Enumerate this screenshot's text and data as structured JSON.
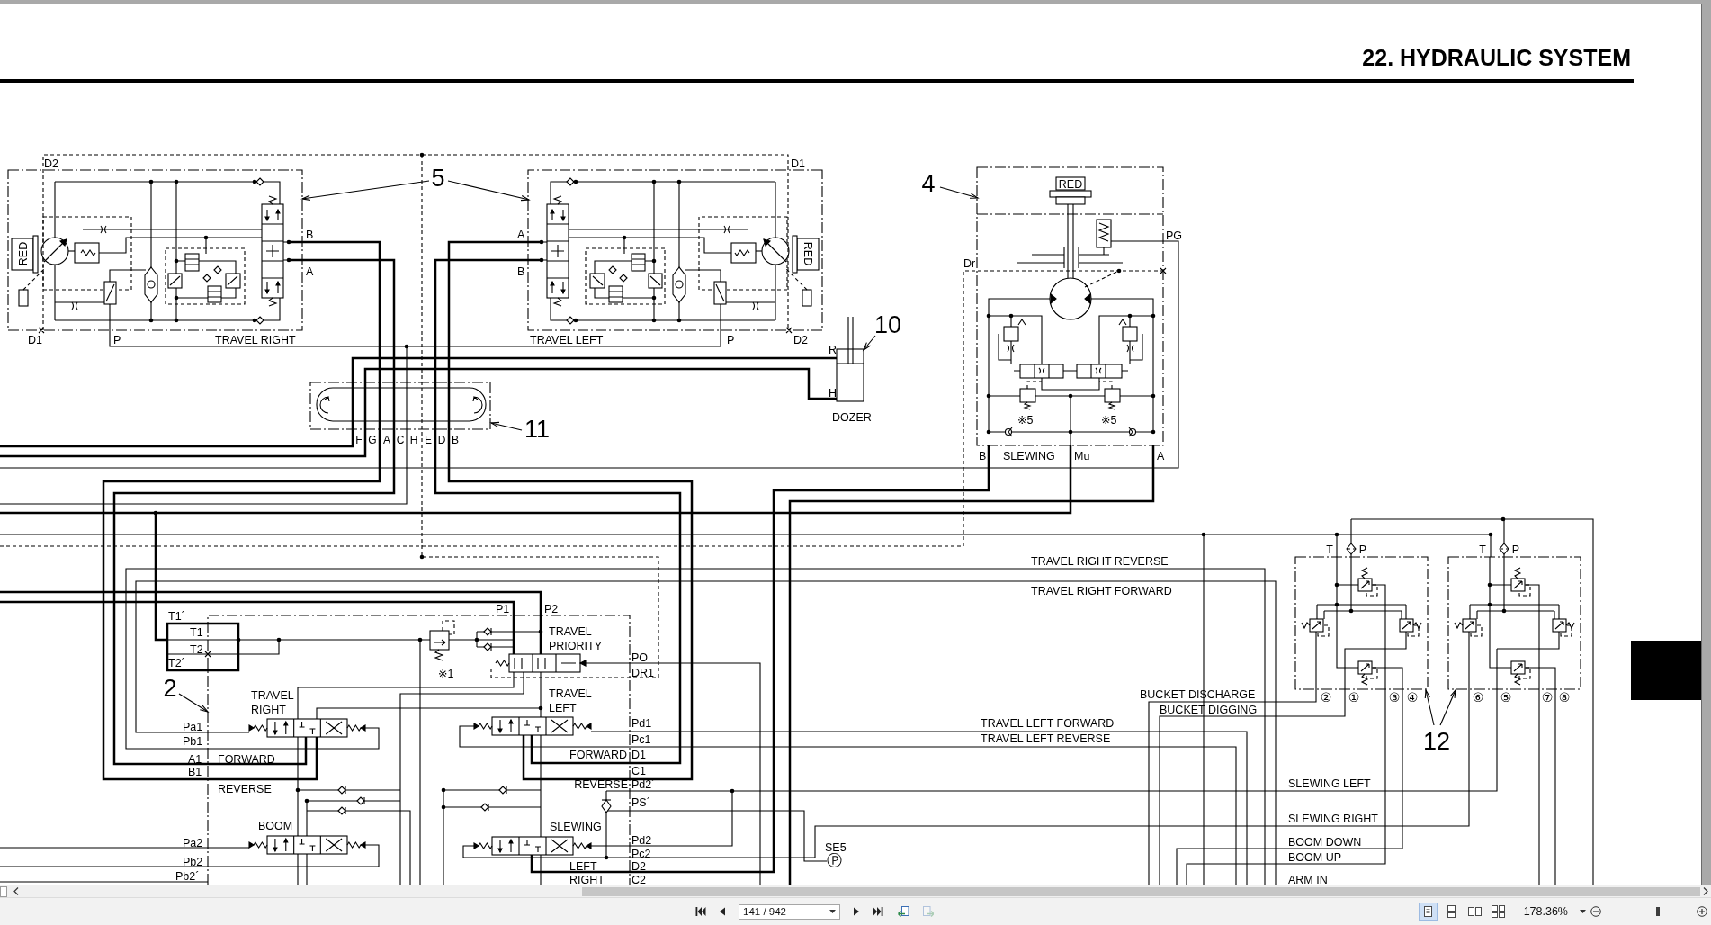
{
  "page": {
    "title": "22. HYDRAULIC SYSTEM"
  },
  "schematic": {
    "callouts": [
      "5",
      "4",
      "10",
      "11",
      "2",
      "12"
    ],
    "travel_motor_right": {
      "reducer": "RED",
      "labels": [
        "D2",
        "B",
        "A",
        "D1",
        "P",
        "TRAVEL RIGHT"
      ]
    },
    "travel_motor_left": {
      "reducer": "RED",
      "labels": [
        "D1",
        "A",
        "B",
        "TRAVEL LEFT",
        "P",
        "D2"
      ]
    },
    "slewing_motor": {
      "reducer": "RED",
      "labels": [
        "PG",
        "Dr",
        "※5",
        "※5",
        "B",
        "SLEWING",
        "Mu",
        "A"
      ]
    },
    "dozer_cylinder": {
      "labels": [
        "R",
        "H",
        "DOZER"
      ]
    },
    "swivel_joint": {
      "ports": [
        "F",
        "G",
        "A",
        "C",
        "H",
        "E",
        "D",
        "B"
      ]
    },
    "control_valve": {
      "labels": [
        "T1´",
        "T1",
        "T2",
        "T2´",
        "P1",
        "P2",
        "TRAVEL PRIORITY",
        "※1",
        "PO",
        "DR1",
        "TRAVEL RIGHT",
        "TRAVEL LEFT",
        "Pa1",
        "Pb1",
        "A1",
        "B1",
        "FORWARD",
        "REVERSE",
        "Pd1",
        "Pc1",
        "FORWARD",
        "D1",
        "C1",
        "REVERSE",
        "Pd2´",
        "PS´",
        "BOOM",
        "SLEWING",
        "Pa2",
        "Pb2",
        "Pb2´",
        "Pd2",
        "Pc2",
        "LEFT",
        "D2",
        "RIGHT",
        "C2"
      ]
    },
    "pilot_valves": {
      "ports": [
        "T",
        "P",
        "T",
        "P"
      ],
      "outlets": [
        "②",
        "①",
        "③",
        "④",
        "⑥",
        "⑤",
        "⑦",
        "⑧"
      ]
    },
    "line_labels": [
      "TRAVEL RIGHT REVERSE",
      "TRAVEL RIGHT FORWARD",
      "BUCKET DISCHARGE",
      "BUCKET DIGGING",
      "TRAVEL LEFT FORWARD",
      "TRAVEL LEFT REVERSE",
      "SLEWING LEFT",
      "SLEWING RIGHT",
      "BOOM DOWN",
      "BOOM UP",
      "ARM IN"
    ],
    "pressure_sensor": {
      "label": "SE5",
      "symbol": "Ⓟ"
    }
  },
  "toolbar": {
    "page_nav_back": [
      {
        "kind": "first",
        "disabled": false
      },
      {
        "kind": "previous",
        "disabled": false
      }
    ],
    "page_field": {
      "value": "141 / 942"
    },
    "page_nav_forward": [
      {
        "kind": "next",
        "disabled": false
      },
      {
        "kind": "last",
        "disabled": false
      }
    ],
    "history_buttons": [
      {
        "kind": "back",
        "disabled": false
      },
      {
        "kind": "forward",
        "disabled": true
      }
    ],
    "view_buttons": [
      {
        "kind": "single",
        "selected": true
      },
      {
        "kind": "continuous",
        "selected": false
      },
      {
        "kind": "facing",
        "selected": false
      },
      {
        "kind": "facing-continuous",
        "selected": false
      }
    ],
    "zoom_level": "178.36%",
    "zoom_slider": {
      "level": 0.6
    }
  }
}
